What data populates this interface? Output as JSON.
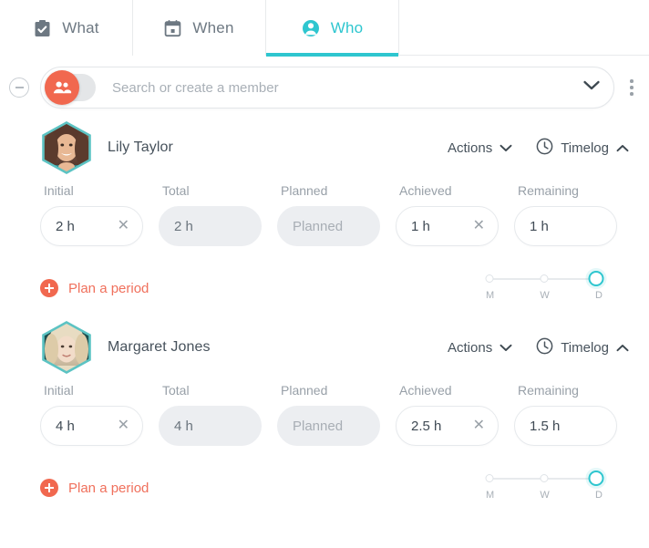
{
  "theme": {
    "accent_teal": "#2ec6cf",
    "accent_salmon": "#f1684f",
    "text_dark": "#47525c",
    "text_muted": "#98a0a8",
    "field_grey": "#eceef1"
  },
  "tabs": [
    {
      "label": "What",
      "icon": "clipboard-check-icon",
      "active": false
    },
    {
      "label": "When",
      "icon": "calendar-icon",
      "active": false
    },
    {
      "label": "Who",
      "icon": "user-circle-icon",
      "active": true
    }
  ],
  "search": {
    "placeholder": "Search or create a member",
    "value": "",
    "toggle_icon": "people-group-icon",
    "toggle_on": false,
    "remove_icon": "minus-circle-icon",
    "expand_icon": "chevron-down-icon",
    "overflow_icon": "kebab-menu-icon"
  },
  "field_labels": {
    "initial": "Initial",
    "total": "Total",
    "planned": "Planned",
    "achieved": "Achieved",
    "remaining": "Remaining"
  },
  "row_controls": {
    "actions_label": "Actions",
    "actions_icon": "chevron-down-icon",
    "timelog_label": "Timelog",
    "timelog_clock_icon": "clock-icon",
    "timelog_icon": "chevron-up-icon",
    "plan_label": "Plan a period",
    "plan_icon": "plus-circle-icon"
  },
  "slider": {
    "stops": [
      "M",
      "W",
      "D"
    ],
    "selected": "D",
    "selected_index": 2
  },
  "members": [
    {
      "name": "Lily Taylor",
      "avatar": "avatar-lily-taylor",
      "initial": "2 h",
      "total": "2 h",
      "planned_placeholder": "Planned",
      "achieved": "1 h",
      "remaining": "1 h"
    },
    {
      "name": "Margaret Jones",
      "avatar": "avatar-margaret-jones",
      "initial": "4 h",
      "total": "4 h",
      "planned_placeholder": "Planned",
      "achieved": "2.5 h",
      "remaining": "1.5 h"
    }
  ]
}
